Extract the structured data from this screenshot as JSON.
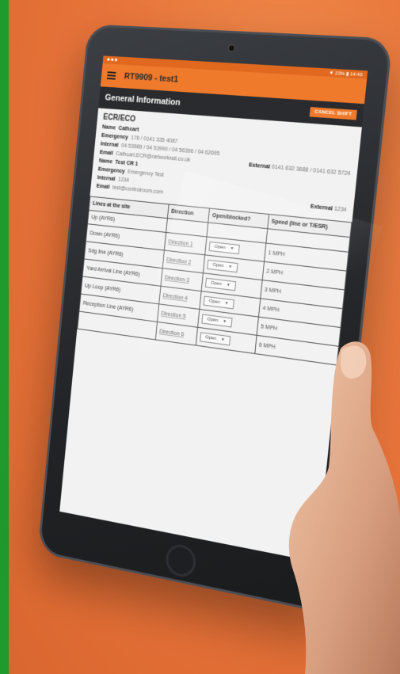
{
  "status_bar": {
    "left": "■ ■ ■",
    "right": "▼ 23% ▮ 14:40"
  },
  "app_bar": {
    "title": "RT9909 - test1"
  },
  "section": {
    "title": "General Information",
    "cancel_label": "CANCEL SHIFT"
  },
  "ecr": {
    "heading": "ECR/ECO",
    "name_label": "Name",
    "name_value": "Cathcart",
    "emergency_label": "Emergency",
    "emergency_value": "176 / 0141 335 4087",
    "internal_label": "Internal",
    "internal_value": "04 53989 / 04 53990 / 04 56396 / 04 62695",
    "email_label": "Email",
    "email_value": "Cathcart.ECR@networkrail.co.uk",
    "external_label": "External",
    "external_value": "0141 632 3688 / 0141 632 5724"
  },
  "cr": {
    "name_label": "Name",
    "name_value": "Test CR 1",
    "emergency_label": "Emergency",
    "emergency_value": "Emergency Test",
    "internal_label": "Internal",
    "internal_value": "1234",
    "email_label": "Email",
    "email_value": "test@controlroom.com",
    "external_label": "External",
    "external_value": "1234"
  },
  "table": {
    "headers": [
      "Lines at the site",
      "Direction",
      "Open/blocked?",
      "Speed (line or T/ESR)"
    ],
    "rows": [
      {
        "line": "Up (AYR6)",
        "direction": "",
        "status": "",
        "speed": ""
      },
      {
        "line": "Down (AYR6)",
        "direction": "Direction 1",
        "status": "Open",
        "speed": "1 MPH"
      },
      {
        "line": "Sdg line (AYR6)",
        "direction": "Direction 2",
        "status": "Open",
        "speed": "2 MPH"
      },
      {
        "line": "Yard Arrival Line (AYR6)",
        "direction": "Direction 3",
        "status": "Open",
        "speed": "3 MPH"
      },
      {
        "line": "Up Loop (AYR6)",
        "direction": "Direction 4",
        "status": "Open",
        "speed": "4 MPH"
      },
      {
        "line": "Reception Line (AYR6)",
        "direction": "Direction 5",
        "status": "Open",
        "speed": "5 MPH"
      },
      {
        "line": "",
        "direction": "Direction 6",
        "status": "Open",
        "speed": "6 MPH"
      }
    ]
  },
  "colors": {
    "background": "#e8743a",
    "app_bar": "#ef7a2c",
    "header": "#2a2b2e",
    "left_strip": "#1f9a2c"
  }
}
